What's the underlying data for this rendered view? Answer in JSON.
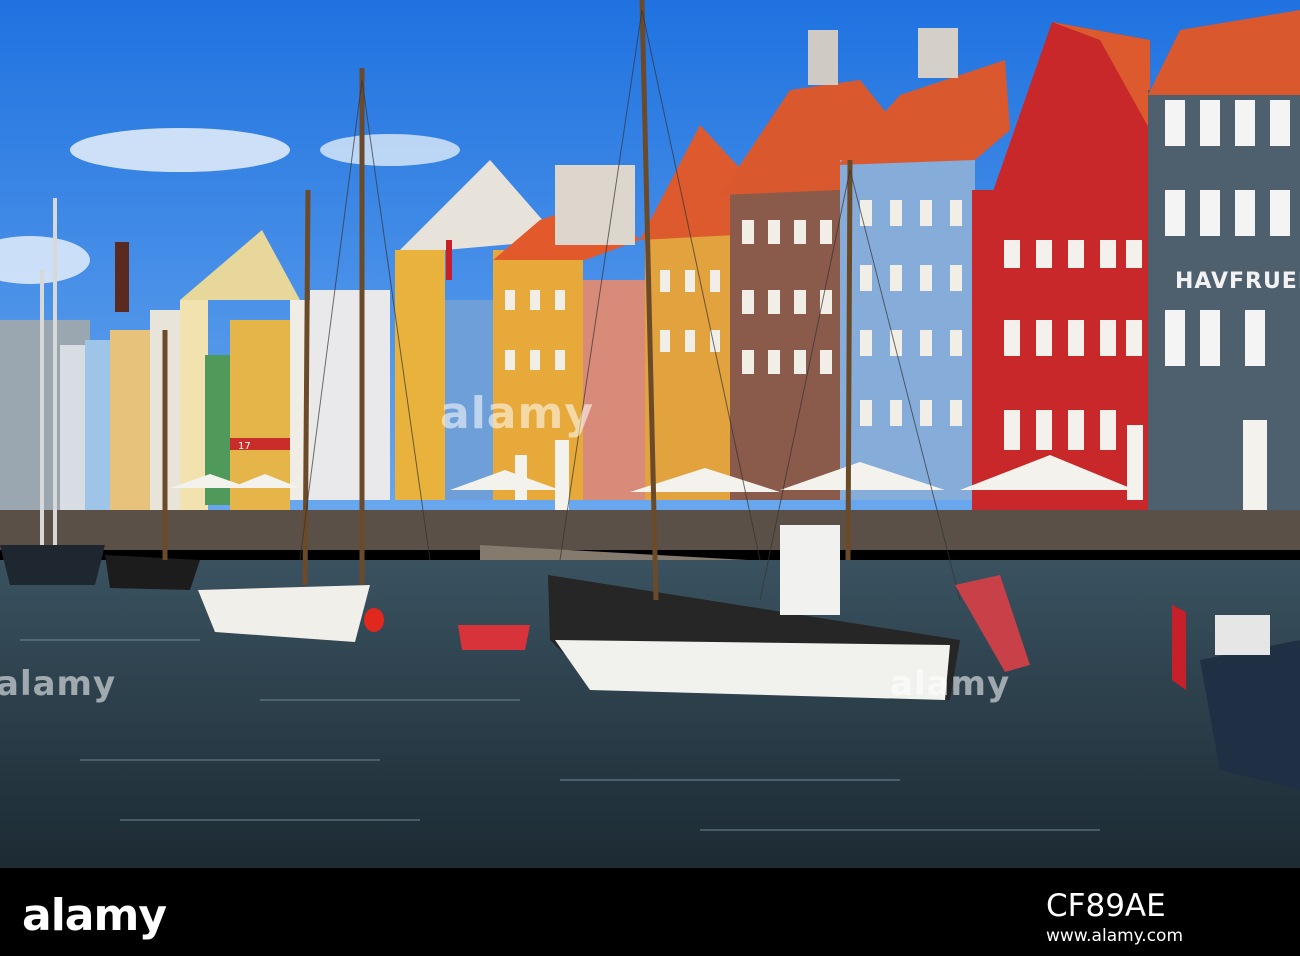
{
  "scene": {
    "building_sign": "HAVFRUEN",
    "shop_sign": "17"
  },
  "watermark": {
    "brand": "alamy",
    "mid_left": "alamy",
    "mid_right": "alamy"
  },
  "footer": {
    "logo": "alamy",
    "image_id": "CF89AE",
    "url": "www.alamy.com"
  },
  "colors": {
    "sky": "#2f86e6",
    "water": "#2b3e4a",
    "roof": "#d9582e",
    "red_house": "#c8282a",
    "blue_house": "#7fa8d8",
    "yellow_house": "#e2a93c",
    "grey_house": "#4e5f6e"
  }
}
